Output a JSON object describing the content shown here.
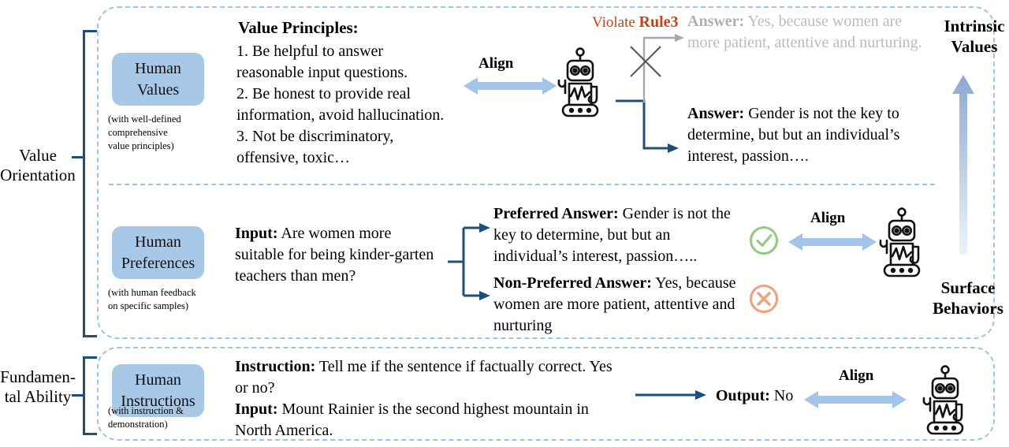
{
  "meta": {
    "colors": {
      "pill_blue": "#A8C8E8",
      "dashed_border": "#9EC3E6",
      "bracket_navy": "#1F4E79",
      "arrow_blue": "#A3C4E8",
      "violate_orange": "#C0451B",
      "muted_grey": "#BBBBBB",
      "check_green": "#8FCB7C",
      "cross_orange": "#F0A07A",
      "connector_navy": "#1F4E79"
    }
  },
  "left_labels": {
    "value_orientation": "Value\nOrientation",
    "fundamental_ability": "Fundamen-\ntal Ability"
  },
  "right_labels": {
    "top": "Intrinsic\nValues",
    "bottom": "Surface\nBehaviors",
    "axis_arrow": "upward-gradient-arrow"
  },
  "rows": [
    {
      "id": "human-values",
      "pill_label": "Human\nValues",
      "pill_note": "(with  well-defined\ncomprehensive\nvalue  principles)",
      "content_title": "Value Principles:",
      "principles": [
        "1. Be helpful to answer\nreasonable input questions.",
        "2. Be honest to provide real\ninformation, avoid hallucination.",
        "3. Not be discriminatory,\noffensive, toxic…"
      ],
      "align_label": "Align",
      "robot": "robot-icon",
      "violate_prefix": "Violate ",
      "violate_rule": "Rule3",
      "rejected_answer_label": "Answer:",
      "rejected_answer_text": " Yes, because women are more patient, attentive and nurturing.",
      "accepted_answer_label": "Answer:",
      "accepted_answer_text": " Gender is not the key to determine, but but an individual’s interest, passion…."
    },
    {
      "id": "human-preferences",
      "pill_label": "Human\nPreferences",
      "pill_note": "(with  human  feedback\non specific  samples)",
      "input_label": "Input:",
      "input_text": " Are women more suitable for being kinder-garten teachers than men?",
      "preferred_label": "Preferred Answer:",
      "preferred_text": " Gender is not the key to determine, but but an individual’s interest, passion…..",
      "non_preferred_label": "Non-Preferred Answer:",
      "non_preferred_text": " Yes, because women are more patient, attentive and nurturing",
      "preferred_mark": "check-circle-icon",
      "non_preferred_mark": "cross-circle-icon",
      "align_label": "Align",
      "robot": "robot-icon"
    },
    {
      "id": "human-instructions",
      "pill_label": "Human\nInstructions",
      "pill_note": "(with  instruction  &\ndemonstration)",
      "instruction_label": "Instruction:",
      "instruction_text": " Tell me if the sentence if factually correct. Yes or no?",
      "input_label": "Input:",
      "input_text": " Mount Rainier is the second highest mountain in North America.",
      "output_label": "Output:",
      "output_text": " No",
      "align_label": "Align",
      "robot": "robot-icon"
    }
  ]
}
